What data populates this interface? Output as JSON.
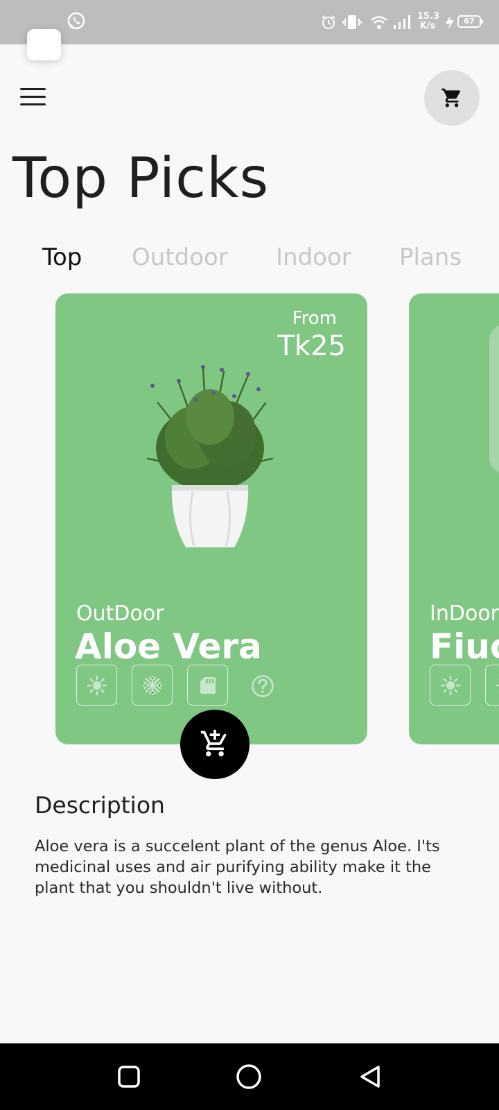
{
  "status_bar": {
    "net_speed_value": "15.3",
    "net_speed_unit": "K/s",
    "battery": "67",
    "icons": [
      "whatsapp-icon",
      "alarm-icon",
      "vibrate-icon",
      "wifi-icon",
      "signal-icon",
      "charging-icon",
      "battery-icon"
    ]
  },
  "header": {
    "menu_icon": "hamburger-menu-icon",
    "cart_icon": "shopping-cart-icon",
    "title": "Top Picks"
  },
  "tabs": [
    {
      "label": "Top",
      "active": true
    },
    {
      "label": "Outdoor",
      "active": false
    },
    {
      "label": "Indoor",
      "active": false
    },
    {
      "label": "Plans",
      "active": false
    }
  ],
  "cards": [
    {
      "from_label": "From",
      "price": "Tk25",
      "category": "OutDoor",
      "name": "Aloe Vera",
      "feature_icons": [
        "sun-icon",
        "snowflake-icon",
        "sd-card-icon",
        "help-icon"
      ],
      "background": "#81c784"
    },
    {
      "category": "InDoor",
      "name": "Fiuc",
      "feature_icons": [
        "sun-icon",
        "snowflake-icon"
      ],
      "background": "#81c784"
    }
  ],
  "description": {
    "title": "Description",
    "text": "Aloe vera is a succelent plant of the genus Aloe. I'ts medicinal uses and air purifying ability make it the plant that you shouldn't live without."
  },
  "nav_bar": {
    "icons": [
      "recents-square-icon",
      "home-circle-icon",
      "back-triangle-icon"
    ]
  },
  "colors": {
    "accent_green": "#81c784",
    "fab": "#000000",
    "status_bar": "#bdbdbd"
  }
}
